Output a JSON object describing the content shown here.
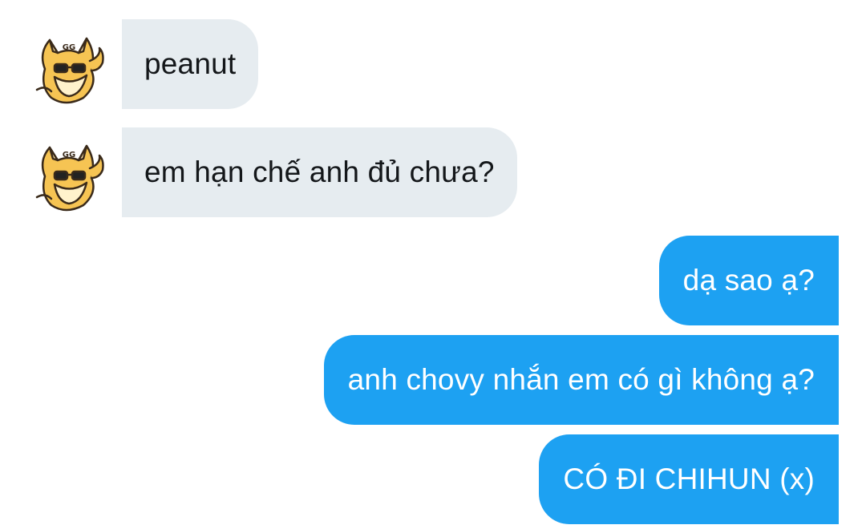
{
  "conversation": {
    "messages": [
      {
        "sender": "other",
        "text": "peanut",
        "avatar_icon": "fox-sunglasses-avatar-icon"
      },
      {
        "sender": "other",
        "text": "em hạn chế anh đủ chưa?",
        "avatar_icon": "fox-sunglasses-avatar-icon"
      },
      {
        "sender": "me",
        "text": "dạ sao ạ?"
      },
      {
        "sender": "me",
        "text": "anh chovy nhắn em có gì không ạ?"
      },
      {
        "sender": "me",
        "text": "CÓ ĐI CHIHUN (x)"
      }
    ]
  },
  "colors": {
    "incoming_bubble": "#e6ecf0",
    "outgoing_bubble": "#1da1f2",
    "incoming_text": "#14171a",
    "outgoing_text": "#ffffff"
  }
}
